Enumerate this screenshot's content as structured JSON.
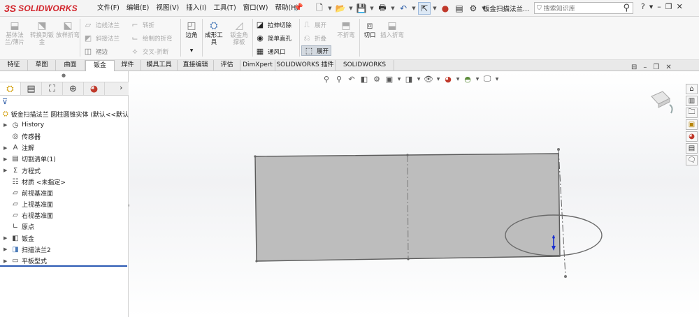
{
  "app": {
    "logo_mark": "3S",
    "logo_text": "SOLIDWORKS"
  },
  "menu": [
    "文件(F)",
    "编辑(E)",
    "视图(V)",
    "插入(I)",
    "工具(T)",
    "窗口(W)",
    "帮助(H)"
  ],
  "quick_access": {
    "icons": [
      "new-icon",
      "open-icon",
      "save-icon",
      "print-icon",
      "undo-icon",
      "select-icon",
      "rebuild-icon",
      "file-properties-icon",
      "options-icon"
    ]
  },
  "document_title": "钣金扫描法兰...",
  "search": {
    "placeholder": "搜索知识库"
  },
  "window_controls": {
    "help": "?",
    "minimize": "–",
    "restore": "❐",
    "close": "✕"
  },
  "ribbon": {
    "base_flange": "基体法兰/薄片",
    "convert_to_sheet": "转换到钣金",
    "lofted_bend": "放样折弯",
    "edge_flange": "边线法兰",
    "miter_flange": "斜接法兰",
    "hem": "褶边",
    "jog": "转折",
    "sketched_bend": "绘制的折弯",
    "cross_break": "交叉-折断",
    "corners": "边角",
    "forming_tool": "成形工具",
    "sheet_metal_gusset": "钣金角撑板",
    "extruded_cut": "拉伸切除",
    "simple_hole": "简单直孔",
    "vent": "通风口",
    "unfold": "展开",
    "fold": "折叠",
    "no_bends": "不折弯",
    "flatten": "展开",
    "rip": "切口",
    "insert_bends": "插入折弯"
  },
  "tabs": [
    "特征",
    "草图",
    "曲面",
    "钣金",
    "焊件",
    "模具工具",
    "直接编辑",
    "评估",
    "DimXpert",
    "SOLIDWORKS 插件",
    "SOLIDWORKS MBD"
  ],
  "active_tab": "钣金",
  "tree": {
    "root": "钣金扫描法兰 圆柱圆锥实体 (默认<<默认",
    "items": [
      {
        "label": "History",
        "icon": "history-icon",
        "expandable": true
      },
      {
        "label": "传感器",
        "icon": "sensor-icon",
        "expandable": false
      },
      {
        "label": "注解",
        "icon": "annotations-icon",
        "expandable": true
      },
      {
        "label": "切割清单(1)",
        "icon": "cut-list-icon",
        "expandable": true
      },
      {
        "label": "方程式",
        "icon": "equations-icon",
        "expandable": true
      },
      {
        "label": "材质 <未指定>",
        "icon": "material-icon",
        "expandable": false
      },
      {
        "label": "前视基准面",
        "icon": "plane-icon",
        "expandable": false
      },
      {
        "label": "上视基准面",
        "icon": "plane-icon",
        "expandable": false
      },
      {
        "label": "右视基准面",
        "icon": "plane-icon",
        "expandable": false
      },
      {
        "label": "原点",
        "icon": "origin-icon",
        "expandable": false
      },
      {
        "label": "钣金",
        "icon": "sheet-metal-icon",
        "expandable": true
      },
      {
        "label": "扫描法兰2",
        "icon": "swept-flange-icon",
        "expandable": true
      },
      {
        "label": "平板型式",
        "icon": "flat-pattern-icon",
        "expandable": true
      }
    ]
  },
  "colors": {
    "accent": "#2b59b3",
    "brand": "#d2232a",
    "part_face": "#bdbdbd"
  }
}
